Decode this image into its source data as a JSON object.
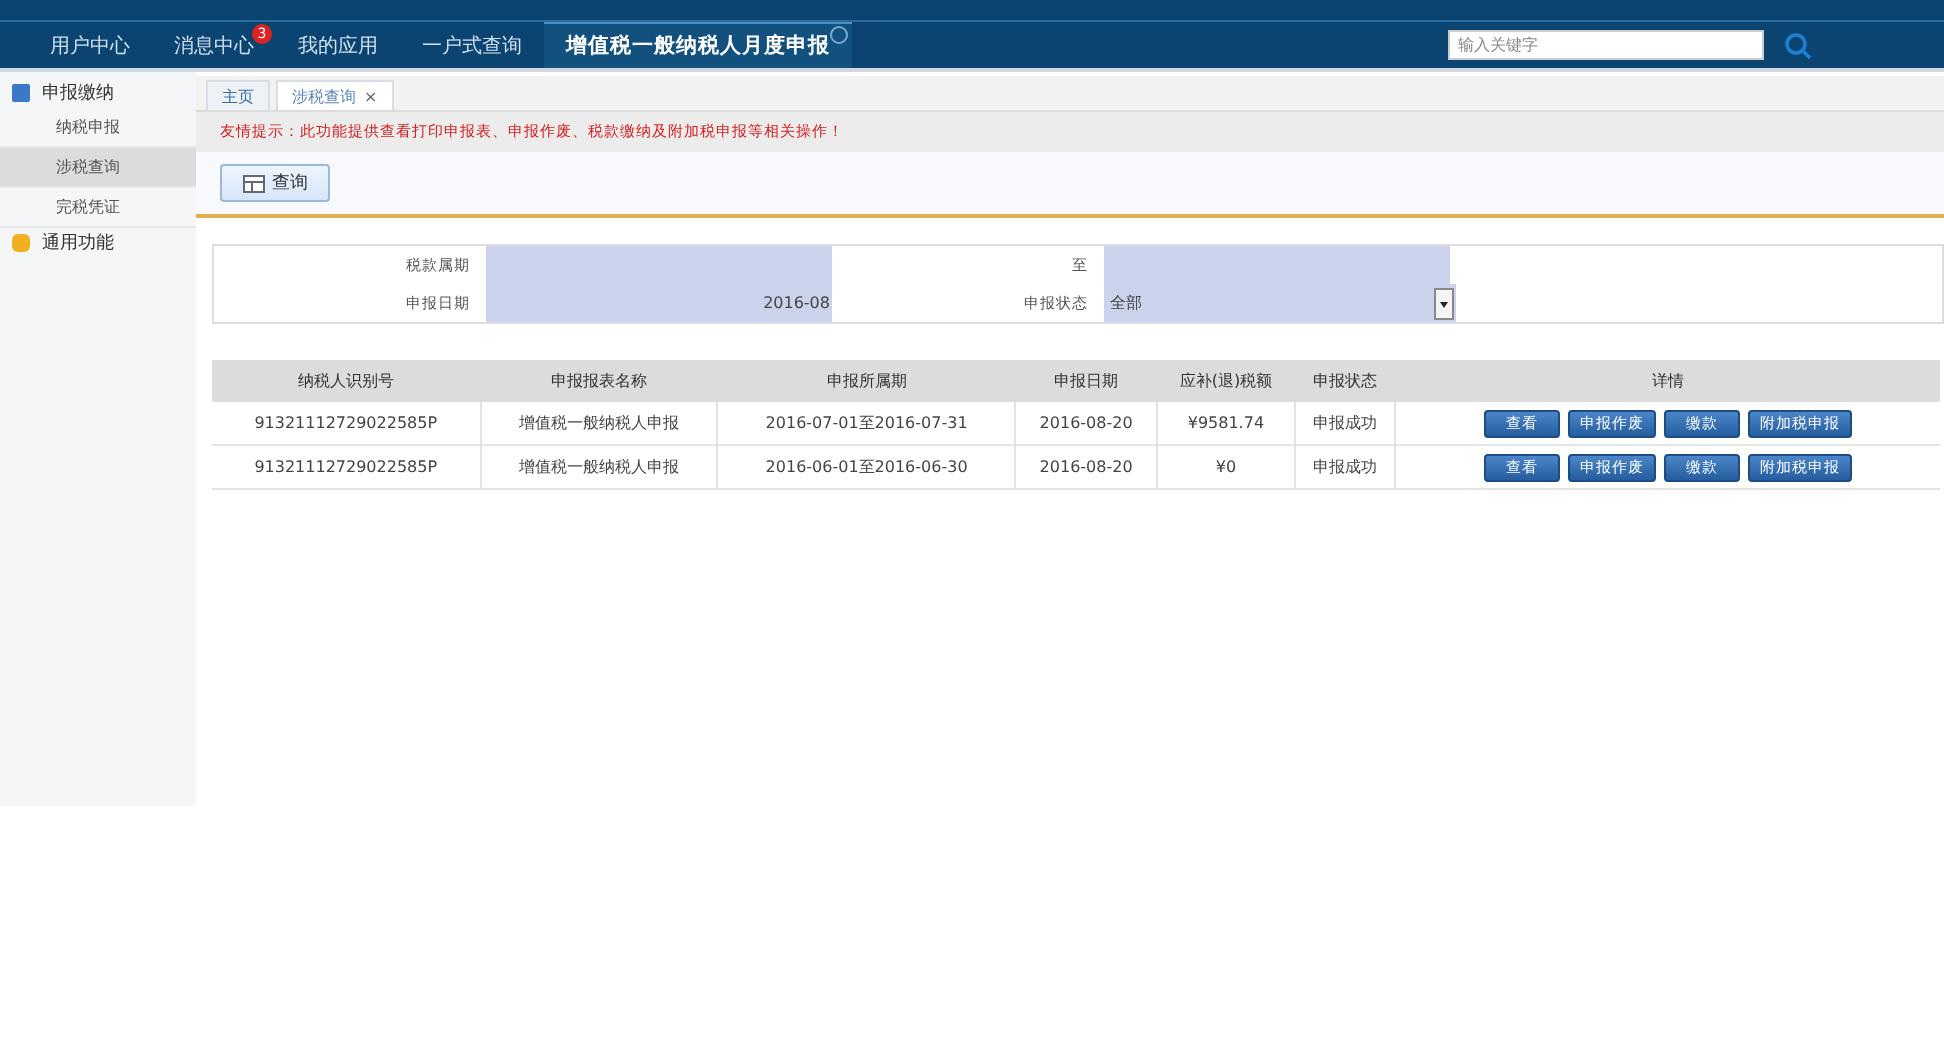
{
  "nav": {
    "items": [
      {
        "label": "用户中心",
        "selected": false
      },
      {
        "label": "消息中心",
        "selected": false,
        "badge": "3"
      },
      {
        "label": "我的应用",
        "selected": false
      },
      {
        "label": "一户式查询",
        "selected": false
      },
      {
        "label": "增值税一般纳税人月度申报",
        "selected": true,
        "closable": true
      }
    ],
    "search": {
      "placeholder": "输入关键字"
    }
  },
  "sidebar": {
    "groups": [
      {
        "label": "申报缴纳",
        "children": [
          {
            "label": "纳税申报",
            "selected": false
          },
          {
            "label": "涉税查询",
            "selected": true
          },
          {
            "label": "完税凭证",
            "selected": false
          }
        ]
      },
      {
        "label": "通用功能"
      }
    ]
  },
  "tabs": [
    {
      "label": "主页",
      "selected": false
    },
    {
      "label": "涉税查询",
      "selected": true,
      "close": "×"
    }
  ],
  "notice": "友情提示：此功能提供查看打印申报表、申报作废、税款缴纳及附加税申报等相关操作！",
  "query_button": "查询",
  "form": {
    "rows": [
      [
        {
          "label": "税款属期"
        },
        {
          "label": "至"
        }
      ],
      [
        {
          "label": "申报日期",
          "value": "2016-08"
        },
        {
          "label": "申报状态",
          "value": "全部",
          "kind": "select"
        }
      ]
    ]
  },
  "table": {
    "columns": [
      "纳税人识别号",
      "申报报表名称",
      "申报所属期",
      "申报日期",
      "应补(退)税额",
      "申报状态",
      "详情"
    ],
    "rows": [
      {
        "cells": [
          "91321112729022585P",
          "增值税一般纳税人申报",
          "2016-07-01至2016-07-31",
          "2016-08-20",
          "¥9581.74",
          "申报成功"
        ],
        "actions": [
          "查看",
          "申报作废",
          "缴款",
          "附加税申报"
        ]
      },
      {
        "cells": [
          "91321112729022585P",
          "增值税一般纳税人申报",
          "2016-06-01至2016-06-30",
          "2016-08-20",
          "¥0",
          "申报成功"
        ],
        "actions": [
          "查看",
          "申报作废",
          "缴款",
          "附加税申报"
        ]
      }
    ]
  }
}
